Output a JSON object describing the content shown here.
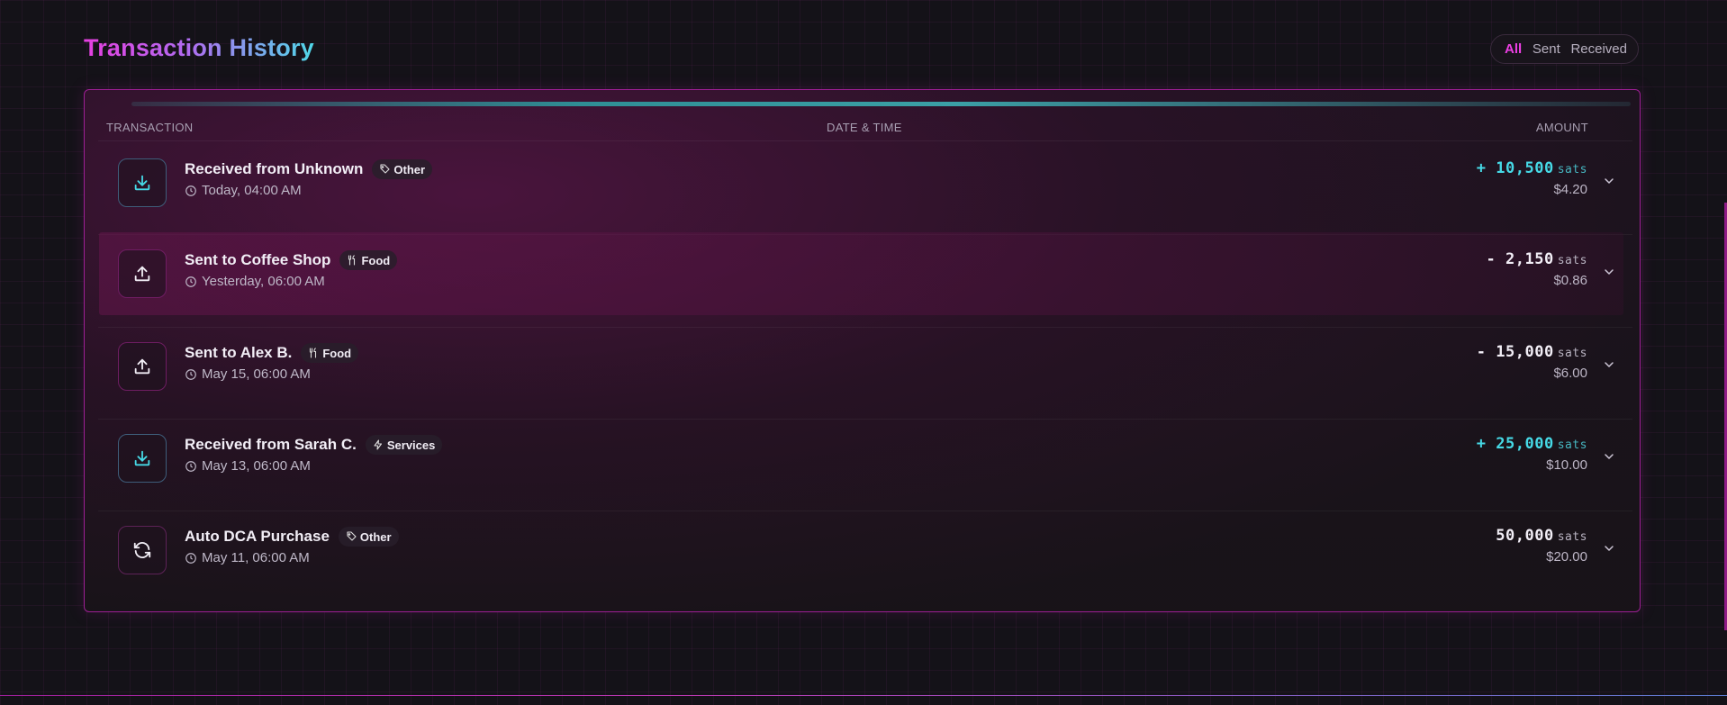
{
  "page": {
    "title": "Transaction History"
  },
  "filters": {
    "all": "All",
    "sent": "Sent",
    "received": "Received",
    "active": "All"
  },
  "table": {
    "headers": {
      "transaction": "TRANSACTION",
      "datetime": "DATE & TIME",
      "amount": "AMOUNT"
    },
    "rows": [
      {
        "name": "Received from Unknown",
        "tag": "Other",
        "tag_icon": "tag-icon",
        "time": "Today, 04:00 AM",
        "sign": "+",
        "amount": "10,500",
        "unit": "sats",
        "usd": "$4.20",
        "direction": "in"
      },
      {
        "name": "Sent to Coffee Shop",
        "tag": "Food",
        "tag_icon": "utensils-icon",
        "time": "Yesterday, 06:00 AM",
        "sign": "-",
        "amount": "2,150",
        "unit": "sats",
        "usd": "$0.86",
        "direction": "out"
      },
      {
        "name": "Sent to Alex B.",
        "tag": "Food",
        "tag_icon": "utensils-icon",
        "time": "May 15, 06:00 AM",
        "sign": "-",
        "amount": "15,000",
        "unit": "sats",
        "usd": "$6.00",
        "direction": "out"
      },
      {
        "name": "Received from Sarah C.",
        "tag": "Services",
        "tag_icon": "lightning-icon",
        "time": "May 13, 06:00 AM",
        "sign": "+",
        "amount": "25,000",
        "unit": "sats",
        "usd": "$10.00",
        "direction": "in"
      },
      {
        "name": "Auto DCA Purchase",
        "tag": "Other",
        "tag_icon": "tag-icon",
        "time": "May 11, 06:00 AM",
        "sign": "",
        "amount": "50,000",
        "unit": "sats",
        "usd": "$20.00",
        "direction": "dca"
      }
    ]
  },
  "colors": {
    "accent_pink": "#ec3fe3",
    "accent_cyan": "#46d9e6",
    "border": "#9d1f94"
  }
}
